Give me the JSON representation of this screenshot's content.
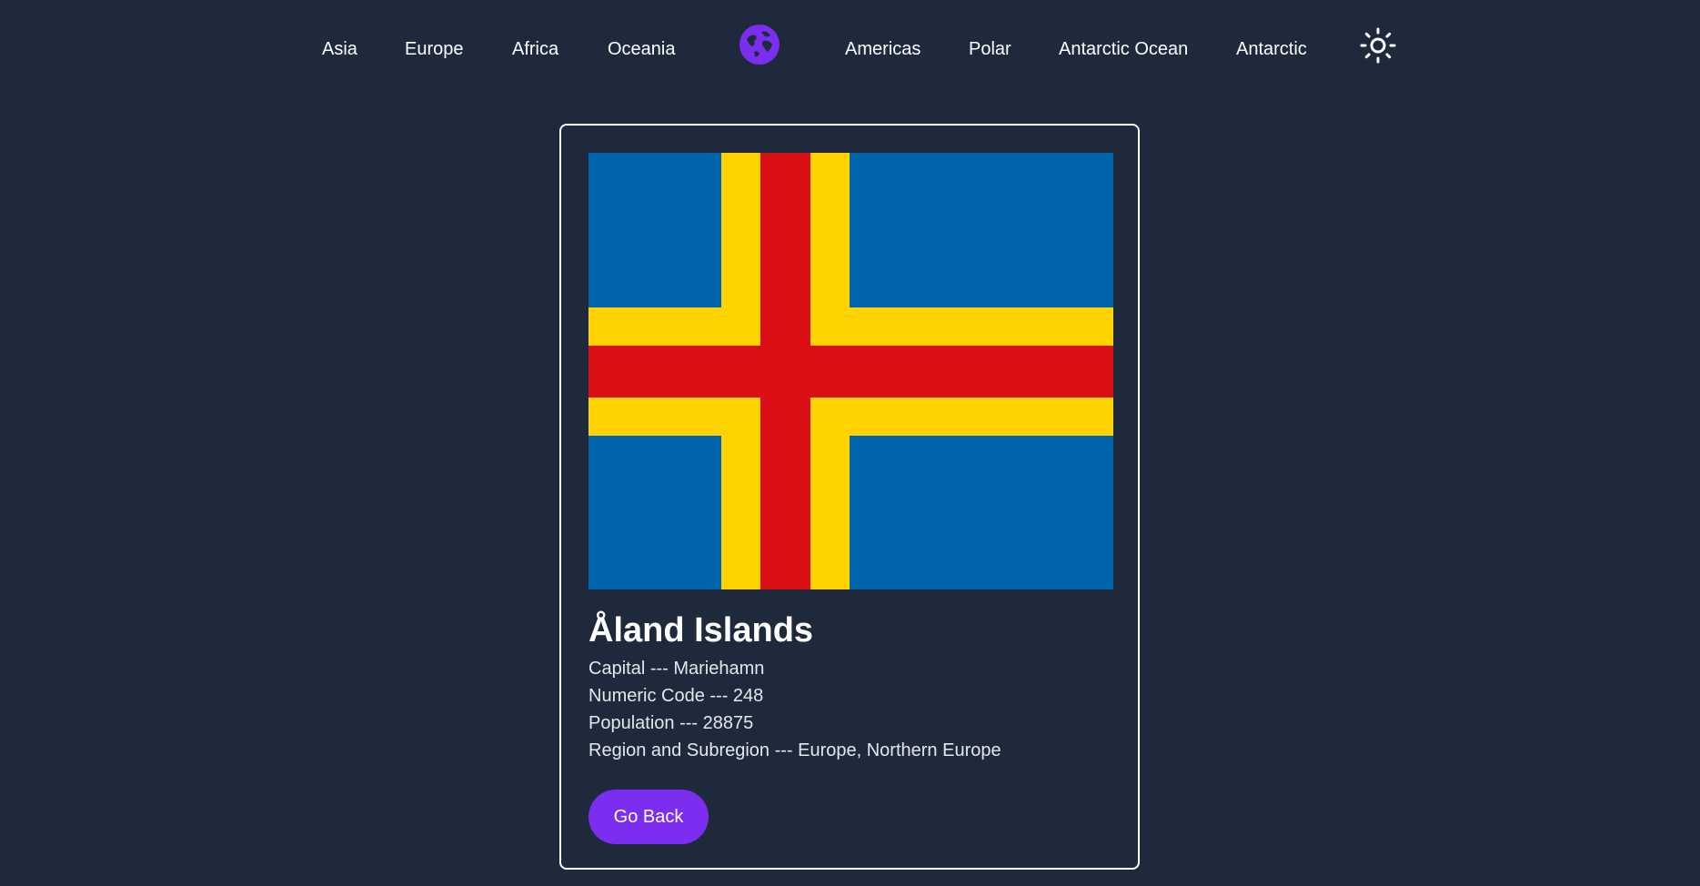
{
  "nav": {
    "links": [
      "Asia",
      "Europe",
      "Africa",
      "Oceania",
      "Americas",
      "Polar",
      "Antarctic Ocean",
      "Antarctic"
    ],
    "logo_icon": "globe-icon",
    "theme_icon": "sun-icon",
    "accent_color": "#7c2ef0"
  },
  "country": {
    "name": "Åland Islands",
    "capital": "Capital --- Mariehamn",
    "numeric_code": "Numeric Code --- 248",
    "population": "Population --- 28875",
    "region": "Region and Subregion --- Europe, Northern Europe",
    "flag_colors": {
      "field": "#0064ad",
      "outer_cross": "#ffd300",
      "inner_cross": "#da0e15"
    }
  },
  "actions": {
    "go_back_label": "Go Back"
  }
}
